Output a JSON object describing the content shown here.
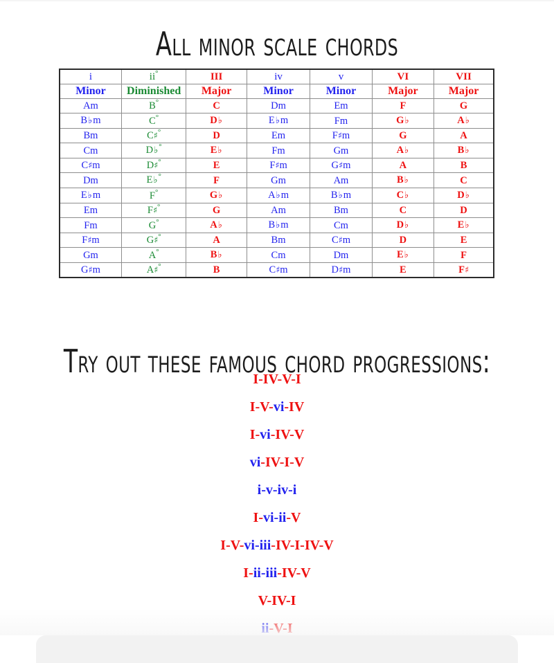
{
  "page": {
    "title": "All minor scale chords",
    "progressions_heading": "Try out these famous chord progressions:"
  },
  "colors": {
    "minor_blue": "#2222ee",
    "diminished_green": "#1a8a33",
    "major_red": "#ee1111",
    "table_border": "#2b2b2b",
    "grid_line": "#8d8d8d",
    "background": "#ffffff"
  },
  "table": {
    "degree_headers": [
      {
        "label": "i",
        "quality_class": "minor"
      },
      {
        "label": "ii°",
        "quality_class": "dim"
      },
      {
        "label": "III",
        "quality_class": "major"
      },
      {
        "label": "iv",
        "quality_class": "minor"
      },
      {
        "label": "v",
        "quality_class": "minor"
      },
      {
        "label": "VI",
        "quality_class": "major"
      },
      {
        "label": "VII",
        "quality_class": "major"
      }
    ],
    "quality_headers": [
      {
        "label": "Minor",
        "quality_class": "minor"
      },
      {
        "label": "Diminished",
        "quality_class": "dim"
      },
      {
        "label": "Major",
        "quality_class": "major"
      },
      {
        "label": "Minor",
        "quality_class": "minor"
      },
      {
        "label": "Minor",
        "quality_class": "minor"
      },
      {
        "label": "Major",
        "quality_class": "major"
      },
      {
        "label": "Major",
        "quality_class": "major"
      }
    ],
    "column_kinds": [
      "minor",
      "dim",
      "major",
      "minor",
      "minor",
      "major",
      "major"
    ],
    "rows": [
      [
        "Am",
        "B°",
        "C",
        "Dm",
        "Em",
        "F",
        "G"
      ],
      [
        "B♭m",
        "C°",
        "D♭",
        "E♭m",
        "Fm",
        "G♭",
        "A♭"
      ],
      [
        "Bm",
        "C♯°",
        "D",
        "Em",
        "F♯m",
        "G",
        "A"
      ],
      [
        "Cm",
        "D♭°",
        "E♭",
        "Fm",
        "Gm",
        "A♭",
        "B♭"
      ],
      [
        "C♯m",
        "D♯°",
        "E",
        "F♯m",
        "G♯m",
        "A",
        "B"
      ],
      [
        "Dm",
        "E♭°",
        "F",
        "Gm",
        "Am",
        "B♭",
        "C"
      ],
      [
        "E♭m",
        "F°",
        "G♭",
        "A♭m",
        "B♭m",
        "C♭",
        "D♭"
      ],
      [
        "Em",
        "F♯°",
        "G",
        "Am",
        "Bm",
        "C",
        "D"
      ],
      [
        "Fm",
        "G°",
        "A♭",
        "B♭m",
        "Cm",
        "D♭",
        "E♭"
      ],
      [
        "F♯m",
        "G♯°",
        "A",
        "Bm",
        "C♯m",
        "D",
        "E"
      ],
      [
        "Gm",
        "A°",
        "B♭",
        "Cm",
        "Dm",
        "E♭",
        "F"
      ],
      [
        "G♯m",
        "A♯°",
        "B",
        "C♯m",
        "D♯m",
        "E",
        "F♯"
      ]
    ]
  },
  "progressions": [
    {
      "text": "I-IV-V-I",
      "tokens": [
        "I",
        "IV",
        "V",
        "I"
      ]
    },
    {
      "text": "I-V-vi-IV",
      "tokens": [
        "I",
        "V",
        "vi",
        "IV"
      ]
    },
    {
      "text": "I-vi-IV-V",
      "tokens": [
        "I",
        "vi",
        "IV",
        "V"
      ]
    },
    {
      "text": "vi-IV-I-V",
      "tokens": [
        "vi",
        "IV",
        "I",
        "V"
      ]
    },
    {
      "text": "i-v-iv-i",
      "tokens": [
        "i",
        "v",
        "iv",
        "i"
      ]
    },
    {
      "text": "I-vi-ii-V",
      "tokens": [
        "I",
        "vi",
        "ii",
        "V"
      ]
    },
    {
      "text": "I-V-vi-iii-IV-I-IV-V",
      "tokens": [
        "I",
        "V",
        "vi",
        "iii",
        "IV",
        "I",
        "IV",
        "V"
      ]
    },
    {
      "text": "I-ii-iii-IV-V",
      "tokens": [
        "I",
        "ii",
        "iii",
        "IV",
        "V"
      ]
    },
    {
      "text": "V-IV-I",
      "tokens": [
        "V",
        "IV",
        "I"
      ]
    },
    {
      "text": "ii-V-I",
      "tokens": [
        "ii",
        "V",
        "I"
      ]
    }
  ]
}
